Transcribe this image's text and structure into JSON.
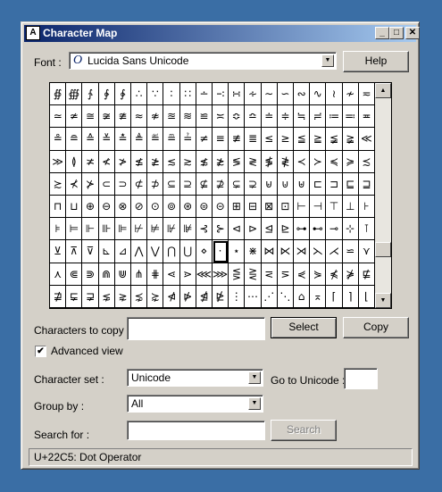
{
  "window": {
    "title": "Character Map"
  },
  "titlebar_buttons": {
    "minimize": "_",
    "maximize": "□",
    "close": "✕"
  },
  "font": {
    "label": "Font :",
    "value": "Lucida Sans Unicode",
    "icon": "O",
    "help_label": "Help"
  },
  "grid": {
    "rows": [
      [
        "∯",
        "∰",
        "∱",
        "∲",
        "∳",
        "∴",
        "∵",
        "∶",
        "∷",
        "∸",
        "∹",
        "∺",
        "∻",
        "∼",
        "∽",
        "∾",
        "∿",
        "≀",
        "≁",
        "≂"
      ],
      [
        "≃",
        "≄",
        "≅",
        "≆",
        "≇",
        "≈",
        "≉",
        "≊",
        "≋",
        "≌",
        "≍",
        "≎",
        "≏",
        "≐",
        "≑",
        "≒",
        "≓",
        "≔",
        "≕",
        "≖"
      ],
      [
        "≗",
        "≘",
        "≙",
        "≚",
        "≛",
        "≜",
        "≝",
        "≞",
        "≟",
        "≠",
        "≡",
        "≢",
        "≣",
        "≤",
        "≥",
        "≦",
        "≧",
        "≨",
        "≩",
        "≪"
      ],
      [
        "≫",
        "≬",
        "≭",
        "≮",
        "≯",
        "≰",
        "≱",
        "≲",
        "≳",
        "≴",
        "≵",
        "≶",
        "≷",
        "≸",
        "≹",
        "≺",
        "≻",
        "≼",
        "≽",
        "≾"
      ],
      [
        "≿",
        "⊀",
        "⊁",
        "⊂",
        "⊃",
        "⊄",
        "⊅",
        "⊆",
        "⊇",
        "⊈",
        "⊉",
        "⊊",
        "⊋",
        "⊌",
        "⊍",
        "⊎",
        "⊏",
        "⊐",
        "⊑",
        "⊒"
      ],
      [
        "⊓",
        "⊔",
        "⊕",
        "⊖",
        "⊗",
        "⊘",
        "⊙",
        "⊚",
        "⊛",
        "⊜",
        "⊝",
        "⊞",
        "⊟",
        "⊠",
        "⊡",
        "⊢",
        "⊣",
        "⊤",
        "⊥",
        "⊦"
      ],
      [
        "⊧",
        "⊨",
        "⊩",
        "⊪",
        "⊫",
        "⊬",
        "⊭",
        "⊮",
        "⊯",
        "⊰",
        "⊱",
        "⊲",
        "⊳",
        "⊴",
        "⊵",
        "⊶",
        "⊷",
        "⊸",
        "⊹",
        "⊺"
      ],
      [
        "⊻",
        "⊼",
        "⊽",
        "⊾",
        "⊿",
        "⋀",
        "⋁",
        "⋂",
        "⋃",
        "⋄",
        "⋅",
        "⋆",
        "⋇",
        "⋈",
        "⋉",
        "⋊",
        "⋋",
        "⋌",
        "⋍",
        "⋎"
      ],
      [
        "⋏",
        "⋐",
        "⋑",
        "⋒",
        "⋓",
        "⋔",
        "⋕",
        "⋖",
        "⋗",
        "⋘",
        "⋙",
        "⋚",
        "⋛",
        "⋜",
        "⋝",
        "⋞",
        "⋟",
        "⋠",
        "⋡",
        "⋢"
      ],
      [
        "⋣",
        "⋤",
        "⋥",
        "⋦",
        "⋧",
        "⋨",
        "⋩",
        "⋪",
        "⋫",
        "⋬",
        "⋭",
        "⋮",
        "⋯",
        "⋰",
        "⋱",
        "⌂",
        "⌅",
        "⌈",
        "⌉",
        "⌊"
      ]
    ],
    "selected": "⋅"
  },
  "copy": {
    "label": "Characters to copy :",
    "value": "",
    "select_label": "Select",
    "copy_label": "Copy"
  },
  "advanced_view": {
    "label": "Advanced view",
    "checked": "✔"
  },
  "character_set": {
    "label": "Character set :",
    "value": "Unicode",
    "goto_label": "Go to Unicode :",
    "goto_value": ""
  },
  "group_by": {
    "label": "Group by :",
    "value": "All"
  },
  "search": {
    "label": "Search for :",
    "value": "",
    "button_label": "Search"
  },
  "status": {
    "text": "U+22C5: Dot Operator"
  },
  "scroll": {
    "up": "▲",
    "down": "▼"
  }
}
